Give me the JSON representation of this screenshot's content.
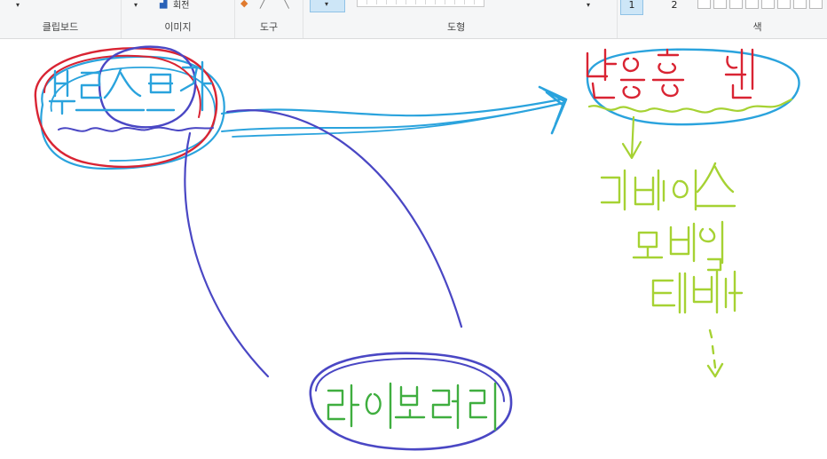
{
  "ribbon": {
    "groups": {
      "clipboard": "클립보드",
      "image": "이미지",
      "tools": "도구",
      "shapes": "도형",
      "colors": "색"
    },
    "image_button_partial": "회전",
    "line_widths": [
      "1",
      "2"
    ]
  },
  "colors": {
    "ink_blue": "#2aa3dd",
    "ink_red": "#d92433",
    "ink_purple": "#4a47c4",
    "ink_green": "#5fbf3a",
    "ink_lime": "#a6d233",
    "selected_bg": "#cde6f7"
  }
}
